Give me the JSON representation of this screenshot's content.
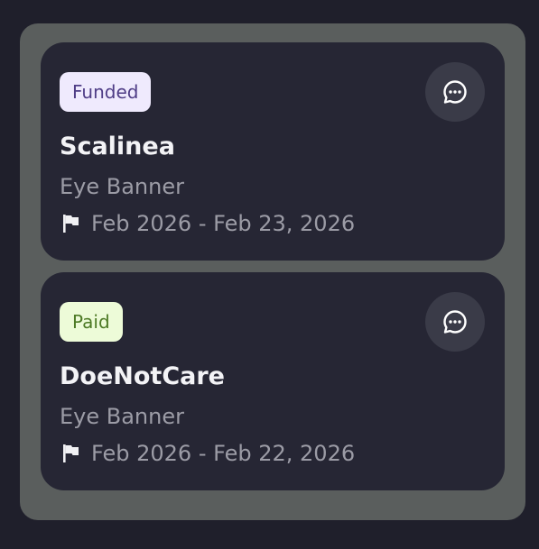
{
  "cards": [
    {
      "status": "Funded",
      "title": "Scalinea",
      "subtitle": "Eye Banner",
      "date_range": "Feb 2026 - Feb 23, 2026",
      "icon": "flag-icon"
    },
    {
      "status": "Paid",
      "title": "DoeNotCare",
      "subtitle": "Eye Banner",
      "date_range": "Feb 2026 - Feb 22, 2026",
      "icon": "flag-icon"
    }
  ],
  "colors": {
    "background": "#1f1f2b",
    "panel": "#5a5e5d",
    "card": "#262634",
    "funded_badge_bg": "#efeafd",
    "funded_badge_text": "#4f3d86",
    "paid_badge_bg": "#edfbd8",
    "paid_badge_text": "#4d7a25"
  }
}
